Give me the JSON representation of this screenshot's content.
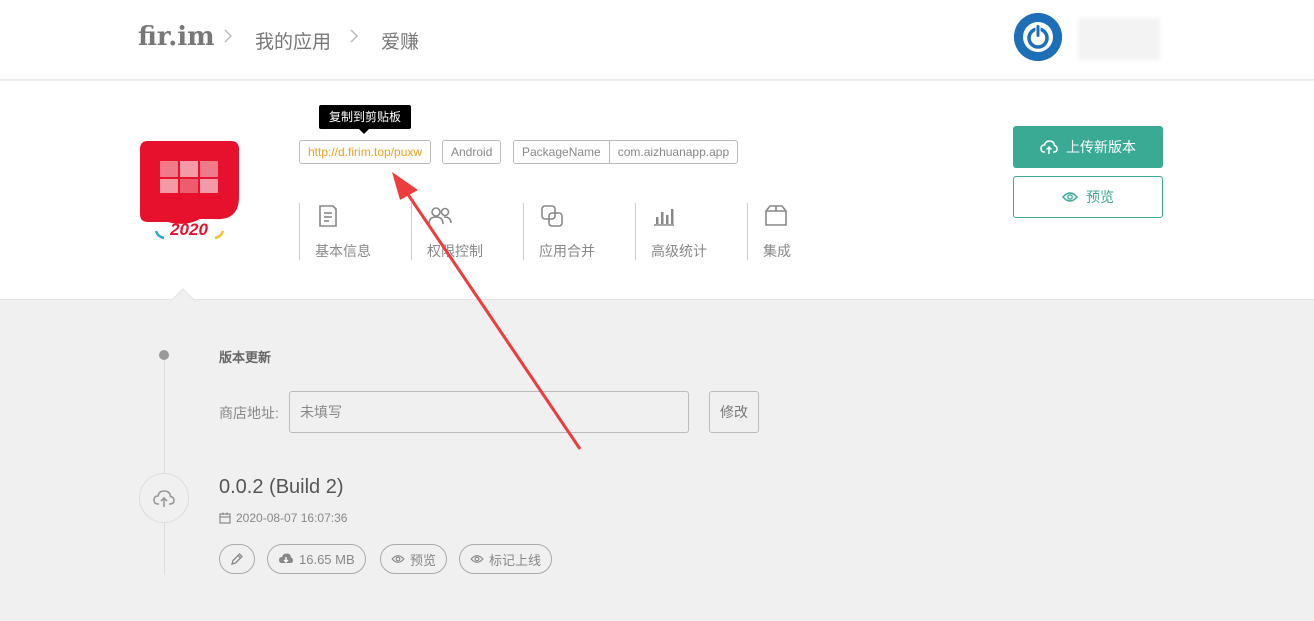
{
  "header": {
    "logo": "fir.im",
    "breadcrumbs": [
      "我的应用",
      "爱赚"
    ]
  },
  "app": {
    "icon_text": "2020",
    "tooltip": "复制到剪贴板",
    "short_link": "http://d.firim.top/puxw",
    "platform": "Android",
    "package_key": "PackageName",
    "package_value": "com.aizhuanapp.app",
    "nav": [
      {
        "label": "基本信息",
        "icon": "document-icon"
      },
      {
        "label": "权限控制",
        "icon": "users-icon"
      },
      {
        "label": "应用合并",
        "icon": "merge-icon"
      },
      {
        "label": "高级统计",
        "icon": "bar-chart-icon"
      },
      {
        "label": "集成",
        "icon": "box-icon"
      }
    ],
    "upload_label": "上传新版本",
    "preview_label": "预览",
    "accent_color": "#3aaa95",
    "link_color": "#f0a020"
  },
  "timeline": {
    "section_title": "版本更新",
    "store_label": "商店地址:",
    "store_placeholder": "未填写",
    "edit_label": "修改",
    "version": "0.0.2 (Build 2)",
    "date": "2020-08-07 16:07:36",
    "size": "16.65 MB",
    "preview_label": "预览",
    "mark_online_label": "标记上线"
  }
}
